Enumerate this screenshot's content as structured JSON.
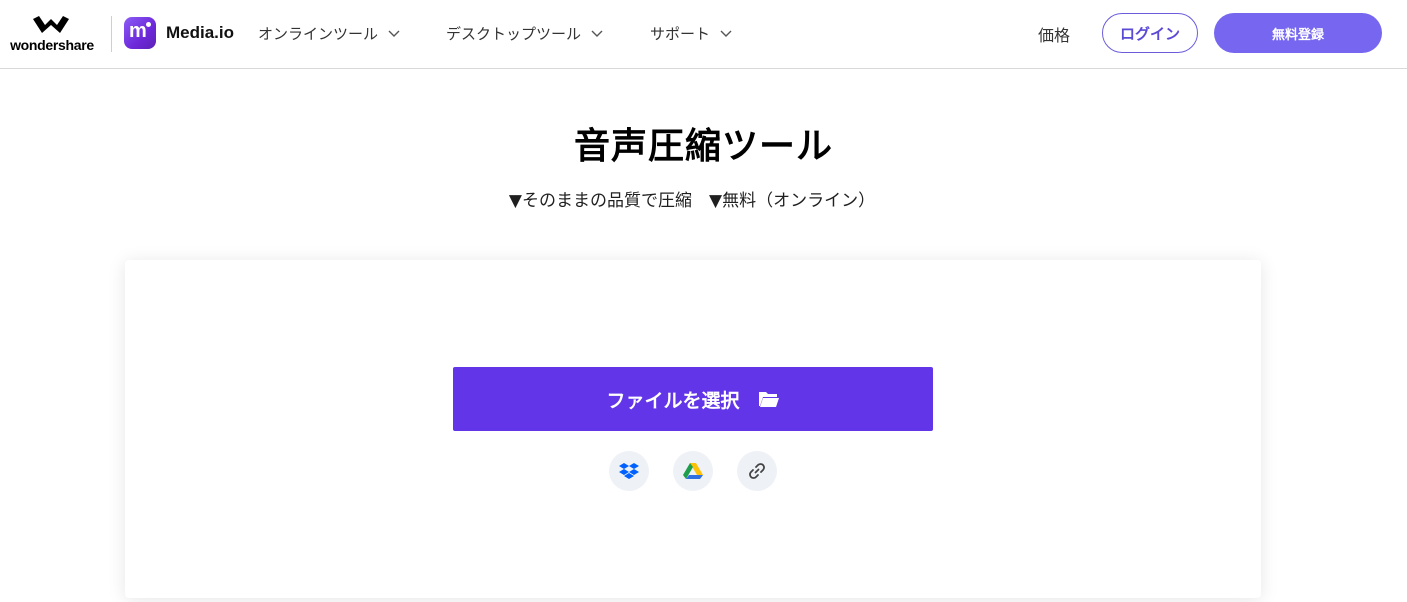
{
  "header": {
    "wondershare_logo_text": "wondershare",
    "app_name": "Media.io",
    "nav": [
      {
        "label": "オンラインツール"
      },
      {
        "label": "デスクトップツール"
      },
      {
        "label": "サポート"
      }
    ],
    "price_label": "価格",
    "login_label": "ログイン",
    "signup_label": "無料登録"
  },
  "hero": {
    "title": "音声圧縮ツール",
    "subtitle": "▼そのままの品質で圧縮　▼無料（オンライン）"
  },
  "upload": {
    "select_file_label": "ファイルを選択",
    "sources": [
      {
        "icon": "dropbox-icon"
      },
      {
        "icon": "google-drive-icon"
      },
      {
        "icon": "link-icon"
      }
    ]
  },
  "colors": {
    "primary_button": "#6236e8",
    "signup_button": "#7666f0",
    "login_border": "#6b5cdc"
  }
}
